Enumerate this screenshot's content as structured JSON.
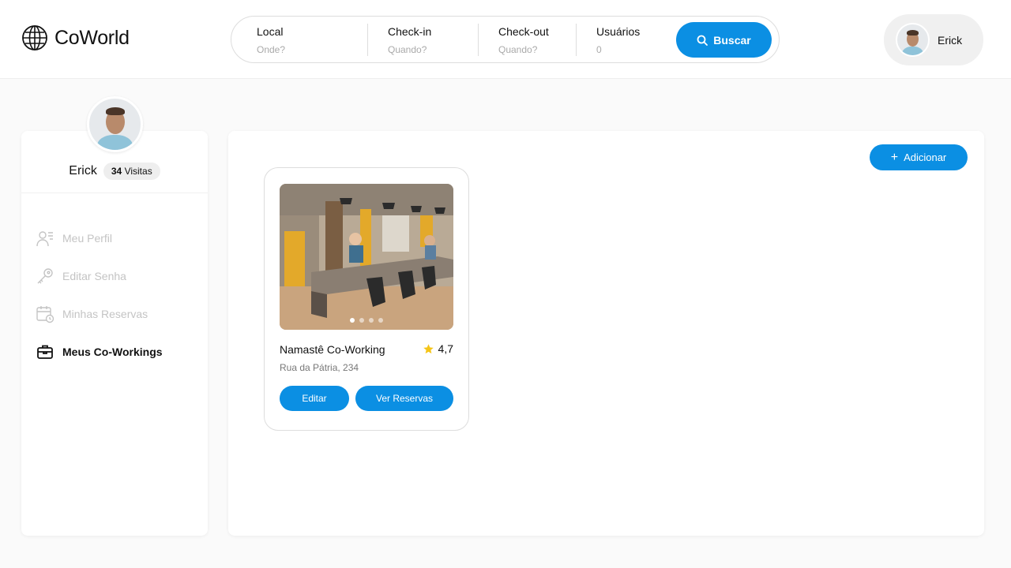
{
  "brand": {
    "name": "CoWorld"
  },
  "search": {
    "fields": [
      {
        "label": "Local",
        "placeholder": "Onde?"
      },
      {
        "label": "Check-in",
        "placeholder": "Quando?"
      },
      {
        "label": "Check-out",
        "placeholder": "Quando?"
      },
      {
        "label": "Usuários",
        "placeholder": "0"
      }
    ],
    "button_label": "Buscar"
  },
  "user": {
    "name": "Erick"
  },
  "profile": {
    "name": "Erick",
    "visits_count": "34",
    "visits_label": "Visitas"
  },
  "sidebar": {
    "items": [
      {
        "label": "Meu Perfil",
        "icon": "user-list-icon",
        "active": false
      },
      {
        "label": "Editar Senha",
        "icon": "key-icon",
        "active": false
      },
      {
        "label": "Minhas Reservas",
        "icon": "calendar-clock-icon",
        "active": false
      },
      {
        "label": "Meus Co-Workings",
        "icon": "briefcase-icon",
        "active": true
      }
    ]
  },
  "main": {
    "add_label": "Adicionar",
    "cards": [
      {
        "title": "Namastê Co-Working",
        "rating": "4,7",
        "address": "Rua da Pátria, 234",
        "edit_label": "Editar",
        "reservations_label": "Ver Reservas",
        "image_count": 4,
        "active_image": 0
      }
    ]
  },
  "colors": {
    "accent": "#0b8fe3",
    "star": "#f5c518",
    "muted": "#c4c4c4"
  }
}
